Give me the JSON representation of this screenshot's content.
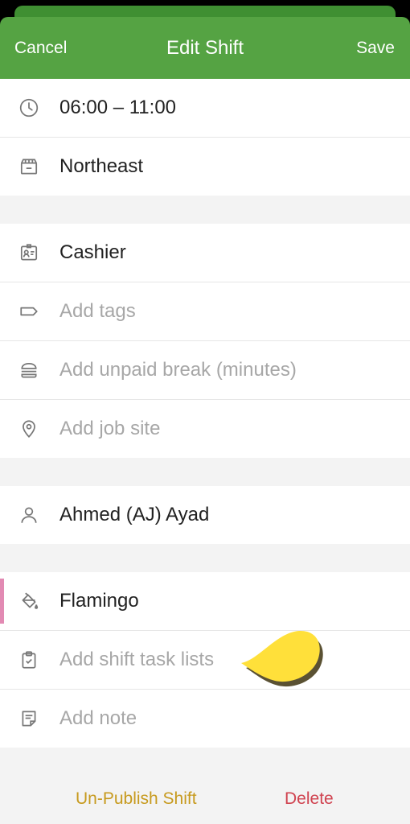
{
  "header": {
    "cancel_label": "Cancel",
    "title": "Edit Shift",
    "save_label": "Save",
    "color": "#55a343"
  },
  "rows": {
    "time": {
      "icon": "clock-icon",
      "text": "06:00 – 11:00"
    },
    "location": {
      "icon": "building-icon",
      "text": "Northeast"
    },
    "position": {
      "icon": "id-badge-icon",
      "text": "Cashier"
    },
    "tags": {
      "icon": "tag-icon",
      "placeholder": "Add tags"
    },
    "break": {
      "icon": "burger-icon",
      "placeholder": "Add unpaid break (minutes)"
    },
    "job_site": {
      "icon": "map-pin-icon",
      "placeholder": "Add job site"
    },
    "employee": {
      "icon": "person-icon",
      "text": "Ahmed (AJ) Ayad"
    },
    "color": {
      "icon": "paint-bucket-icon",
      "text": "Flamingo",
      "swatch": "#e28ab3"
    },
    "task_lists": {
      "icon": "clipboard-check-icon",
      "placeholder": "Add shift task lists"
    },
    "note": {
      "icon": "note-icon",
      "placeholder": "Add note"
    }
  },
  "footer": {
    "unpublish_label": "Un-Publish Shift",
    "unpublish_color": "#c79a1e",
    "delete_label": "Delete",
    "delete_color": "#d04350"
  },
  "pointer": {
    "icon": "yellow-pointer-icon",
    "color": "#ffe03a"
  }
}
